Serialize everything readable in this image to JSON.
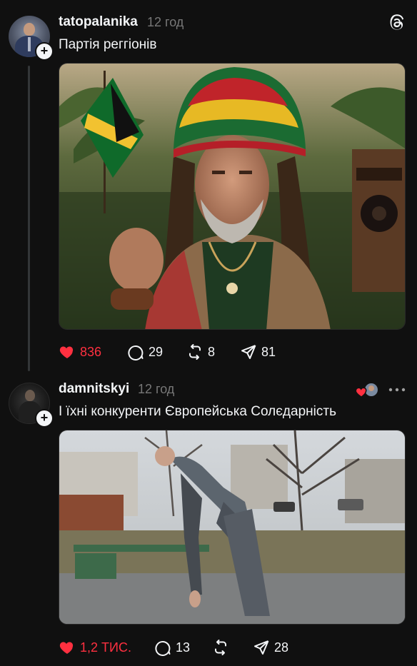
{
  "posts": [
    {
      "username": "tatopalanika",
      "time": "12 год",
      "caption": "Партія реггіонів",
      "media_description_icon": "photo",
      "stats": {
        "likes": "836",
        "comments": "29",
        "reposts": "8",
        "shares": "81"
      },
      "liked": true
    },
    {
      "username": "damnitskyi",
      "time": "12 год",
      "caption": "І їхні конкуренти Європейська Солєдарність",
      "stats": {
        "likes": "1,2 ТИС.",
        "comments": "13",
        "reposts": "",
        "shares": "28"
      },
      "liked": true
    }
  ],
  "colors": {
    "background": "#101010",
    "text": "#f3f5f7",
    "muted": "#777777",
    "like": "#ff3040",
    "thread_line": "#333638"
  },
  "icons": {
    "app": "threads-logo-icon",
    "like": "heart-icon",
    "comment": "comment-bubble-icon",
    "repost": "repost-icon",
    "share": "send-icon",
    "follow": "plus-icon",
    "more": "more-dots-icon"
  }
}
